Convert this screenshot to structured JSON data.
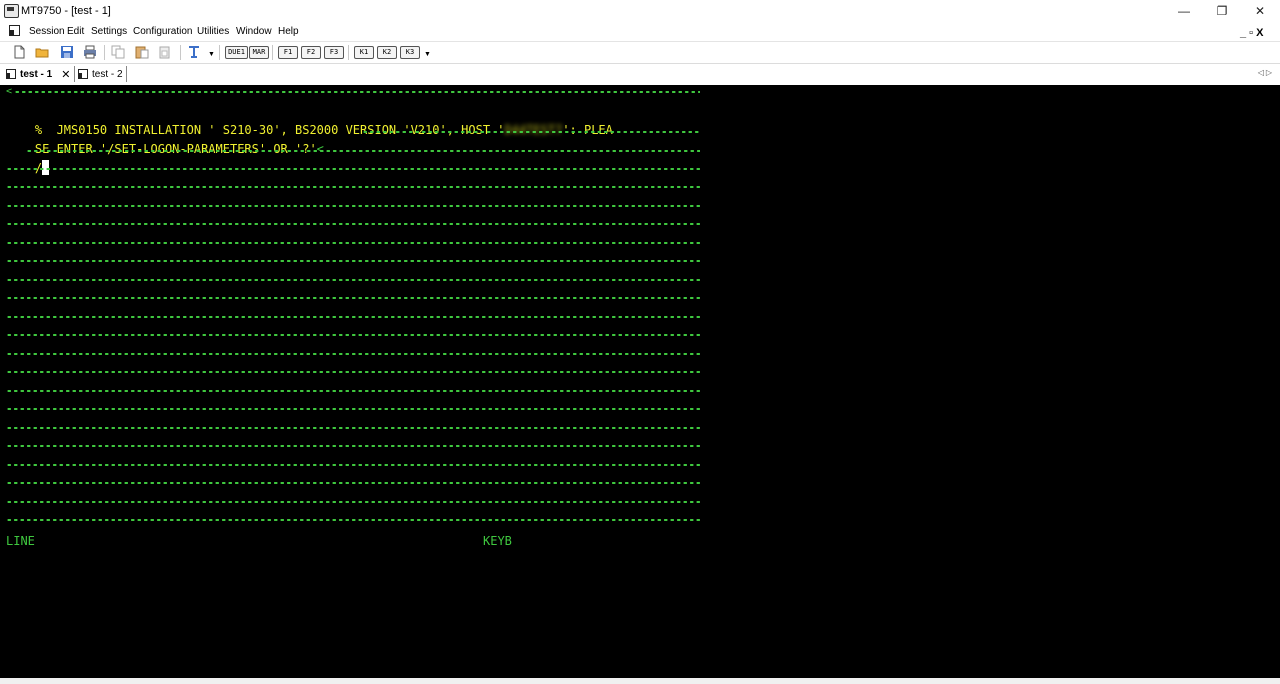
{
  "window": {
    "title": "MT9750 - [test - 1]",
    "minimize_glyph": "—",
    "restore_glyph": "❐",
    "close_glyph": "✕"
  },
  "menu": {
    "items": [
      "Session",
      "Edit",
      "Settings",
      "Configuration",
      "Utilities",
      "Window",
      "Help"
    ],
    "mdi_controls": "_ ▫ X"
  },
  "toolbar": {
    "icons": [
      "new-document-icon",
      "open-folder-icon",
      "save-icon",
      "print-icon",
      "copy-icon",
      "paste-icon",
      "paste-special-icon",
      "text-font-icon"
    ],
    "keys": [
      "DUE1",
      "MAR",
      "F1",
      "F2",
      "F3",
      "K1",
      "K2",
      "K3"
    ]
  },
  "tabs": [
    {
      "label": "test - 1",
      "active": true,
      "close": "✕"
    },
    {
      "label": "test - 2",
      "active": false
    }
  ],
  "terminal": {
    "line1_a": "%  JMS0150 INSTALLATION ' S210-30', BS2000 VERSION 'V210', HOST '",
    "line1_host": "D44TEST7",
    "line1_b": "': PLEA",
    "line2": "SE ENTER '/SET-LOGON-PARAMETERS' OR '?'",
    "line2_marker": "<",
    "line3_prompt": "/",
    "top_marker": "<",
    "status_left": "LINE",
    "status_right": "KEYB"
  },
  "colors": {
    "terminal_bg": "#000000",
    "text_yellow": "#f1f130",
    "field_green": "#3fc83f"
  }
}
